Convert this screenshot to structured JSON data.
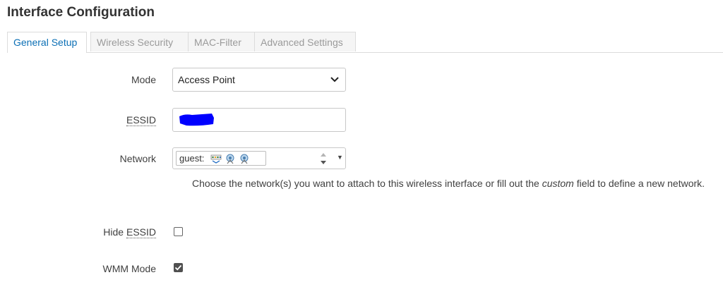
{
  "page": {
    "title": "Interface Configuration"
  },
  "tabs": [
    {
      "label": "General Setup",
      "active": true
    },
    {
      "label": "Wireless Security",
      "active": false
    },
    {
      "label": "MAC-Filter",
      "active": false
    },
    {
      "label": "Advanced Settings",
      "active": false
    }
  ],
  "form": {
    "mode": {
      "label": "Mode",
      "value": "Access Point"
    },
    "essid": {
      "label": "ESSID",
      "value": ""
    },
    "network": {
      "label": "Network",
      "value": "guest:",
      "icons": [
        "ethernet-switch-icon",
        "wifi-icon",
        "wifi-icon"
      ],
      "help_before": "Choose the network(s) you want to attach to this wireless interface or fill out the ",
      "help_em": "custom",
      "help_after": " field to define a new network."
    },
    "hide_essid": {
      "label_prefix": "Hide ",
      "label_abbr": "ESSID",
      "checked": false
    },
    "wmm_mode": {
      "label": "WMM Mode",
      "checked": true
    }
  },
  "colors": {
    "accent": "#0b6fb5",
    "redaction": "#0000ff"
  }
}
